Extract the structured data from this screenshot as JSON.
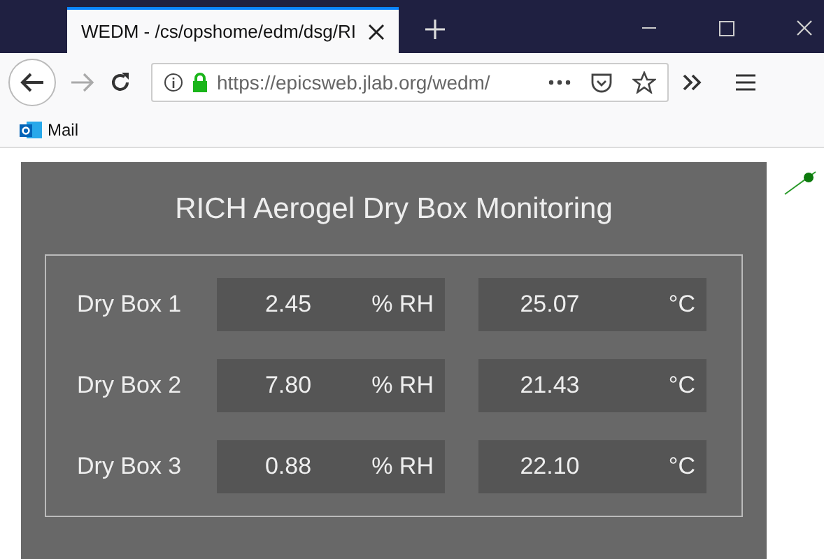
{
  "browser": {
    "tab_title": "WEDM - /cs/opshome/edm/dsg/RI",
    "url": "https://epicsweb.jlab.org/wedm/",
    "bookmarks": [
      {
        "label": "Mail"
      }
    ]
  },
  "panel": {
    "title": "RICH Aerogel Dry Box Monitoring",
    "rows": [
      {
        "label": "Dry Box 1",
        "humidity": "2.45",
        "humidity_unit": "% RH",
        "temperature": "25.07",
        "temperature_unit": "°C"
      },
      {
        "label": "Dry Box 2",
        "humidity": "7.80",
        "humidity_unit": "% RH",
        "temperature": "21.43",
        "temperature_unit": "°C"
      },
      {
        "label": "Dry Box 3",
        "humidity": "0.88",
        "humidity_unit": "% RH",
        "temperature": "22.10",
        "temperature_unit": "°C"
      }
    ]
  }
}
